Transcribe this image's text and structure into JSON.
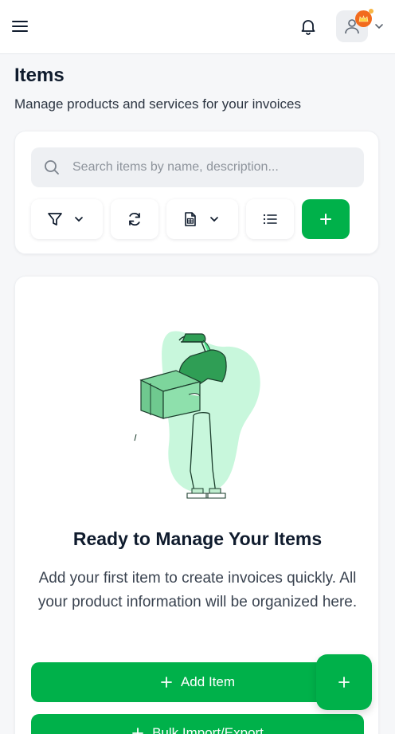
{
  "header": {
    "menu_icon": "hamburger-icon",
    "notification_icon": "bell-icon",
    "profile_icon": "user-icon",
    "premium_badge_icon": "crown-icon"
  },
  "page": {
    "title": "Items",
    "subtitle": "Manage products and services for your invoices"
  },
  "toolbar": {
    "search_placeholder": "Search items by name, description...",
    "buttons": [
      {
        "name": "filter",
        "icon": "filter-icon"
      },
      {
        "name": "refresh",
        "icon": "refresh-icon"
      },
      {
        "name": "export",
        "icon": "spreadsheet-icon"
      },
      {
        "name": "view",
        "icon": "list-icon"
      },
      {
        "name": "add",
        "icon": "plus-icon"
      }
    ]
  },
  "empty_state": {
    "title": "Ready to Manage Your Items",
    "description": "Add your first item to create invoices quickly. All your product information will be organized here.",
    "add_button_label": "Add Item",
    "bulk_button_label": "Bulk Import/Export"
  },
  "colors": {
    "brand_green": "#00b14a",
    "badge_orange": "#f26b1d",
    "illustration_mint": "#c8f7dc"
  }
}
